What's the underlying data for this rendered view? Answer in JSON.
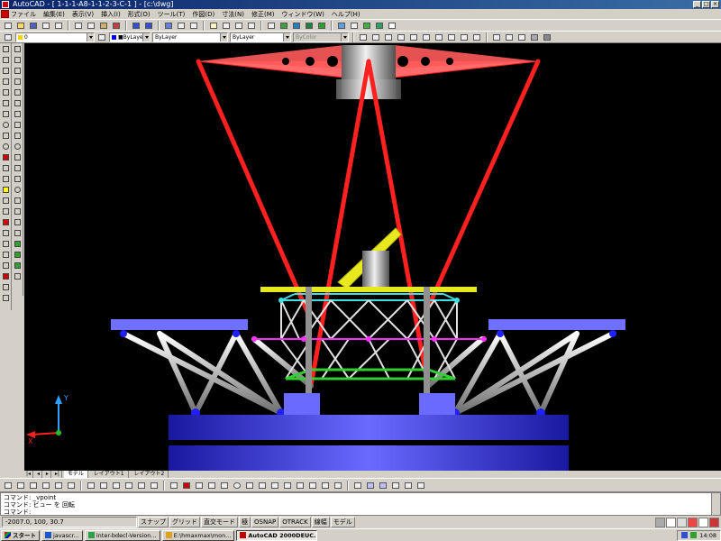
{
  "window": {
    "title": "AutoCAD - [ 1-1-1-A8-1-1-2-3-C-1 ] - [c:\\dwg]",
    "menus": [
      "ファイル",
      "編集(E)",
      "表示(V)",
      "挿入(I)",
      "形式(O)",
      "ツール(T)",
      "作図(D)",
      "寸法(N)",
      "修正(M)",
      "ウィンドウ(W)",
      "ヘルプ(H)"
    ]
  },
  "layers": {
    "current_layer": "0",
    "color_combo": "■ByLayer",
    "linetype_combo": "ByLayer",
    "lineweight_combo": "ByLayer",
    "plotstyle_combo": "ByColor"
  },
  "viewport": {
    "background": "#000000",
    "colors": {
      "frame_red": "#ff2020",
      "top_plate_red": "#ff5a5a",
      "platform_blue": "#3535d8",
      "plate_light_blue": "#7070ff",
      "cylinder_grey": "#b0b0b0",
      "yellow_plate": "#e8e820",
      "truss_cyan": "#40e0e0",
      "truss_magenta": "#ff30ff",
      "truss_green": "#30d030",
      "joint_blue": "#2020ff"
    },
    "ucs_icon": {
      "axis_x": "X",
      "axis_y": "Y"
    }
  },
  "layout_tabs": [
    "モデル",
    "レイアウト1",
    "レイアウト2"
  ],
  "command_line": {
    "lines": [
      "コマンド: _vpoint",
      "コマンド: ビュー を 回転",
      "コマンド:"
    ]
  },
  "status": {
    "coordinates": "-2007.0, 100, 30.7",
    "modes": [
      "スナップ",
      "グリッド",
      "直交モード",
      "極",
      "OSNAP",
      "OTRACK",
      "線幅",
      "モデル"
    ]
  },
  "taskbar": {
    "start": "スタート",
    "tasks": [
      {
        "label": "javascr...",
        "color": "#1b57c7"
      },
      {
        "label": "inter-bdecl-Version...",
        "color": "#2fa04a"
      },
      {
        "label": "E:\\hmaxmax\\mon...",
        "color": "#e0a020"
      },
      {
        "label": "AutoCAD 2000DEUC...",
        "color": "#c00000"
      },
      {
        "label": "2000DEUC",
        "color": "#c00000"
      }
    ],
    "clock": "14:08"
  }
}
